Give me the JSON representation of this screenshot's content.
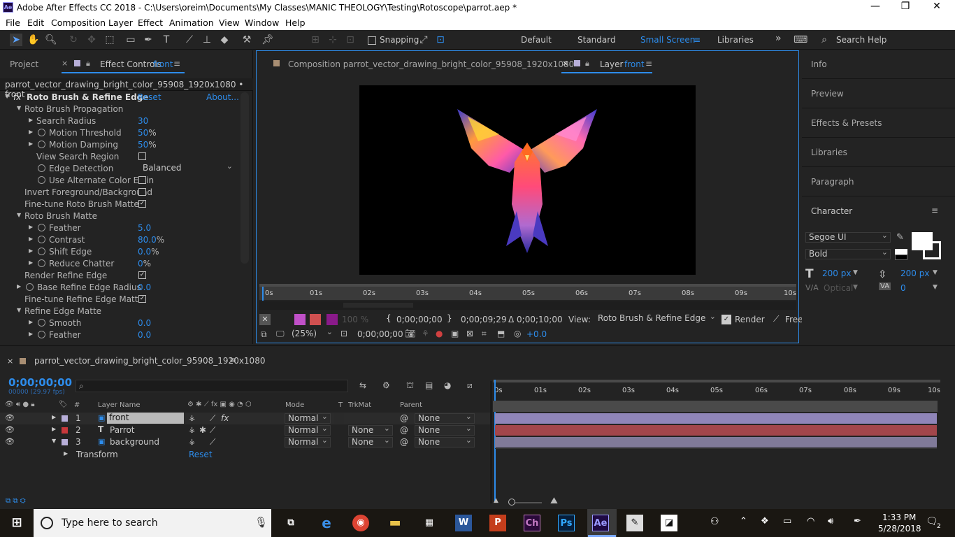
{
  "window": {
    "title": "Adobe After Effects CC 2018 - C:\\Users\\oreim\\Documents\\My Classes\\MANIC THEOLOGY\\Testing\\Rotoscope\\parrot.aep *",
    "app_badge": "Ae",
    "minimize": "—",
    "restore": "❐",
    "close": "✕"
  },
  "menu": [
    "File",
    "Edit",
    "Composition",
    "Layer",
    "Effect",
    "Animation",
    "View",
    "Window",
    "Help"
  ],
  "toolbar": {
    "snapping_label": "Snapping",
    "workspaces": [
      "Default",
      "Standard",
      "Small Screen",
      "Libraries"
    ],
    "active_workspace": "Small Screen",
    "more": "»",
    "search_placeholder": "Search Help"
  },
  "project_panel": {
    "tab": "Project"
  },
  "effect_controls": {
    "tab_prefix": "Effect Controls",
    "tab_layer": "front",
    "breadcrumb": "parrot_vector_drawing_bright_color_95908_1920x1080 • front",
    "fx_badge": "fx",
    "effect_name": "Roto Brush & Refine Edge",
    "reset": "Reset",
    "about": "About...",
    "rows": [
      {
        "label": "Roto Brush Propagation"
      },
      {
        "label": "Search Radius",
        "value": "30"
      },
      {
        "label": "Motion Threshold",
        "value": "50",
        "unit": "%"
      },
      {
        "label": "Motion Damping",
        "value": "50",
        "unit": "%"
      },
      {
        "label": "View Search Region"
      },
      {
        "label": "Edge Detection",
        "value": "Balanced"
      },
      {
        "label": "Use Alternate Color Estin"
      },
      {
        "label": "Invert Foreground/Background"
      },
      {
        "label": "Fine-tune Roto Brush Matte"
      },
      {
        "label": "Roto Brush Matte"
      },
      {
        "label": "Feather",
        "value": "5.0"
      },
      {
        "label": "Contrast",
        "value": "80.0",
        "unit": "%"
      },
      {
        "label": "Shift Edge",
        "value": "0.0",
        "unit": "%"
      },
      {
        "label": "Reduce Chatter",
        "value": "0",
        "unit": "%"
      },
      {
        "label": "Render Refine Edge"
      },
      {
        "label": "Base Refine Edge Radius",
        "value": "0.0"
      },
      {
        "label": "Fine-tune Refine Edge Matte"
      },
      {
        "label": "Refine Edge Matte"
      },
      {
        "label": "Smooth",
        "value": "0.0"
      },
      {
        "label": "Feather",
        "value": "0.0"
      }
    ]
  },
  "viewer": {
    "comp_tab": "Composition parrot_vector_drawing_bright_color_95908_1920x1080",
    "layer_tab_prefix": "Layer",
    "layer_tab_name": "front",
    "ruler": [
      "0s",
      "01s",
      "02s",
      "03s",
      "04s",
      "05s",
      "06s",
      "07s",
      "08s",
      "09s",
      "10s"
    ],
    "opacity": "100 %",
    "in_time": "0;00;00;00",
    "out_time": "0;00;09;29",
    "duration": "Δ 0;00;10;00",
    "view_label": "View:",
    "view_value": "Roto Brush & Refine Edge",
    "render_label": "Render",
    "free_label": "Free",
    "zoom": "(25%)",
    "current_time": "0;00;00;00",
    "exposure": "+0.0"
  },
  "right_panels": [
    "Info",
    "Preview",
    "Effects & Presets",
    "Libraries",
    "Paragraph"
  ],
  "character": {
    "title": "Character",
    "font": "Segoe UI",
    "style": "Bold",
    "size": "200 px",
    "leading": "200 px",
    "kerning": "Optical",
    "tracking": "0"
  },
  "timeline": {
    "comp_name": "parrot_vector_drawing_bright_color_95908_1920x1080",
    "timecode": "0;00;00;00",
    "frames": "00000 (29.97 fps)",
    "search_placeholder": "",
    "ruler": [
      "0s",
      "01s",
      "02s",
      "03s",
      "04s",
      "05s",
      "06s",
      "07s",
      "08s",
      "09s",
      "10s"
    ],
    "headers": {
      "num": "#",
      "layer_name": "Layer Name",
      "mode": "Mode",
      "t": "T",
      "trkmat": "TrkMat",
      "parent": "Parent"
    },
    "layers": [
      {
        "num": "1",
        "name": "front",
        "mode": "Normal",
        "trkmat": "",
        "parent": "None",
        "color": "#b7aed8",
        "bar": "#8f85b8"
      },
      {
        "num": "2",
        "name": "Parrot",
        "mode": "Normal",
        "trkmat": "None",
        "parent": "None",
        "color": "#c8383c",
        "bar": "#a3464b"
      },
      {
        "num": "3",
        "name": "background",
        "mode": "Normal",
        "trkmat": "None",
        "parent": "None",
        "color": "#b7aed8",
        "bar": "#807a99"
      }
    ],
    "transform_label": "Transform",
    "transform_reset": "Reset"
  },
  "taskbar": {
    "search_placeholder": "Type here to search",
    "time": "1:33 PM",
    "date": "5/28/2018",
    "notifications": "2"
  }
}
